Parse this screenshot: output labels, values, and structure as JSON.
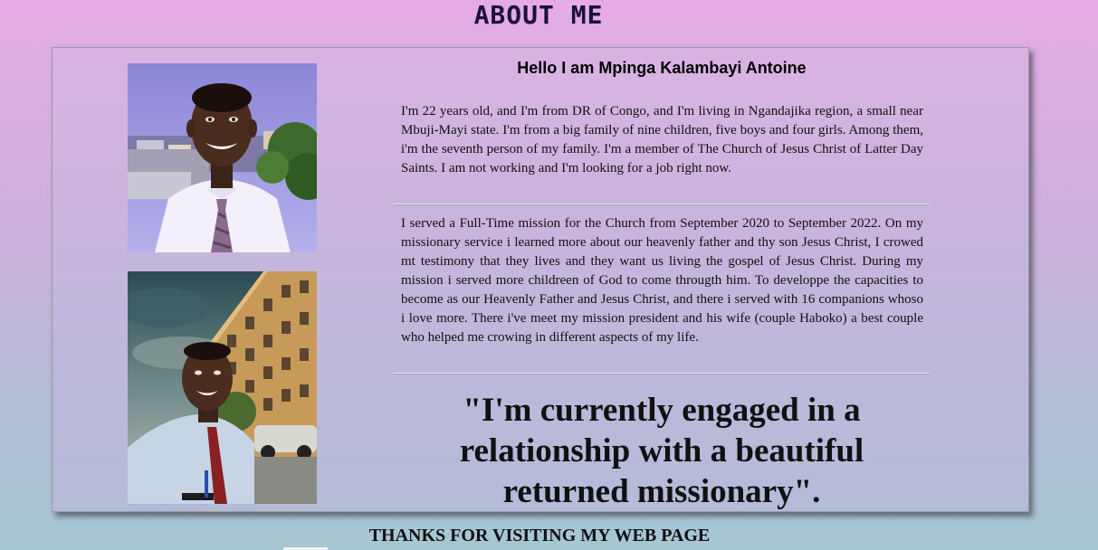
{
  "page": {
    "title": "ABOUT ME",
    "footer": "THANKS FOR VISITING MY WEB PAGE"
  },
  "profile": {
    "greeting": "Hello I am Mpinga Kalambayi Antoine",
    "paragraph_1": "I'm 22 years old, and I'm from DR of Congo, and I'm living in Ngandajika region, a small near Mbuji-Mayi state. I'm from a big family of nine children, five boys and four girls. Among them, i'm the seventh person of my family. I'm a member of The Church of Jesus Christ of Latter Day Saints. I am not working and I'm looking for a job right now.",
    "paragraph_2": "I served a Full-Time mission for the Church from September 2020 to September 2022. On my missionary service i learned more about our heavenly father and thy son Jesus Christ, I crowed mt testimony that they lives and they want us living the gospel of Jesus Christ. During my mission i served more childreen of God to come througth him. To developpe the capacities to become as our Heavenly Father and Jesus Christ, and there i served with 16 companions whoso i love more. There i've meet my mission president and his wife (couple Haboko) a best couple who helped me crowing in different aspects of my life.",
    "quote": "\"I'm currently engaged in a relationship with a beautiful returned missionary\"."
  },
  "photos": [
    {
      "icon": "portrait-photo-icon"
    },
    {
      "icon": "selfie-photo-icon"
    }
  ]
}
